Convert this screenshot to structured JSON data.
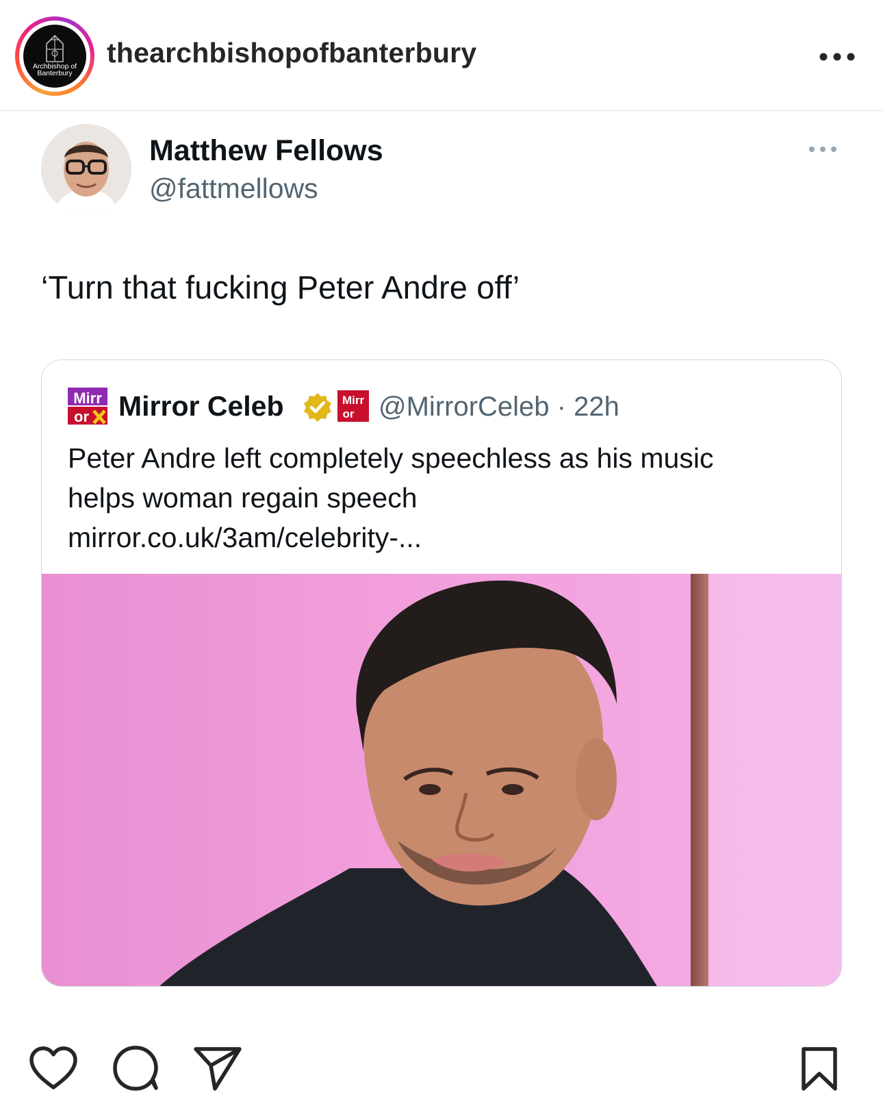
{
  "instagram": {
    "username": "thearchbishopofbanterbury",
    "avatar_text": "Archbishop of Banterbury",
    "more_icon": "more-horizontal-icon"
  },
  "tweet": {
    "author_name": "Matthew Fellows",
    "author_handle": "@fattmellows",
    "text": "‘Turn that fucking Peter Andre off’",
    "more_icon": "more-horizontal-icon"
  },
  "quoted_tweet": {
    "logo_text": "Mirror",
    "name": "Mirror Celeb",
    "verified_icon": "verified-badge-icon",
    "handle_time": "@MirrorCeleb · 22h",
    "text_lines": [
      "Peter Andre left completely speechless as his music",
      "helps woman regain speech",
      "mirror.co.uk/3am/celebrity-..."
    ],
    "image_description": "photo"
  },
  "actions": {
    "like_icon": "heart-icon",
    "comment_icon": "comment-icon",
    "share_icon": "send-icon",
    "save_icon": "bookmark-icon"
  },
  "colors": {
    "handle_gray": "#536471",
    "ring_gradient": [
      "#f9a33a",
      "#e8228c",
      "#a334c9"
    ],
    "mirror_red": "#c8102e",
    "mirror_purple": "#8f2ab0",
    "verified_gold": "#e2b719",
    "photo_pink": "#ee9ad6"
  }
}
